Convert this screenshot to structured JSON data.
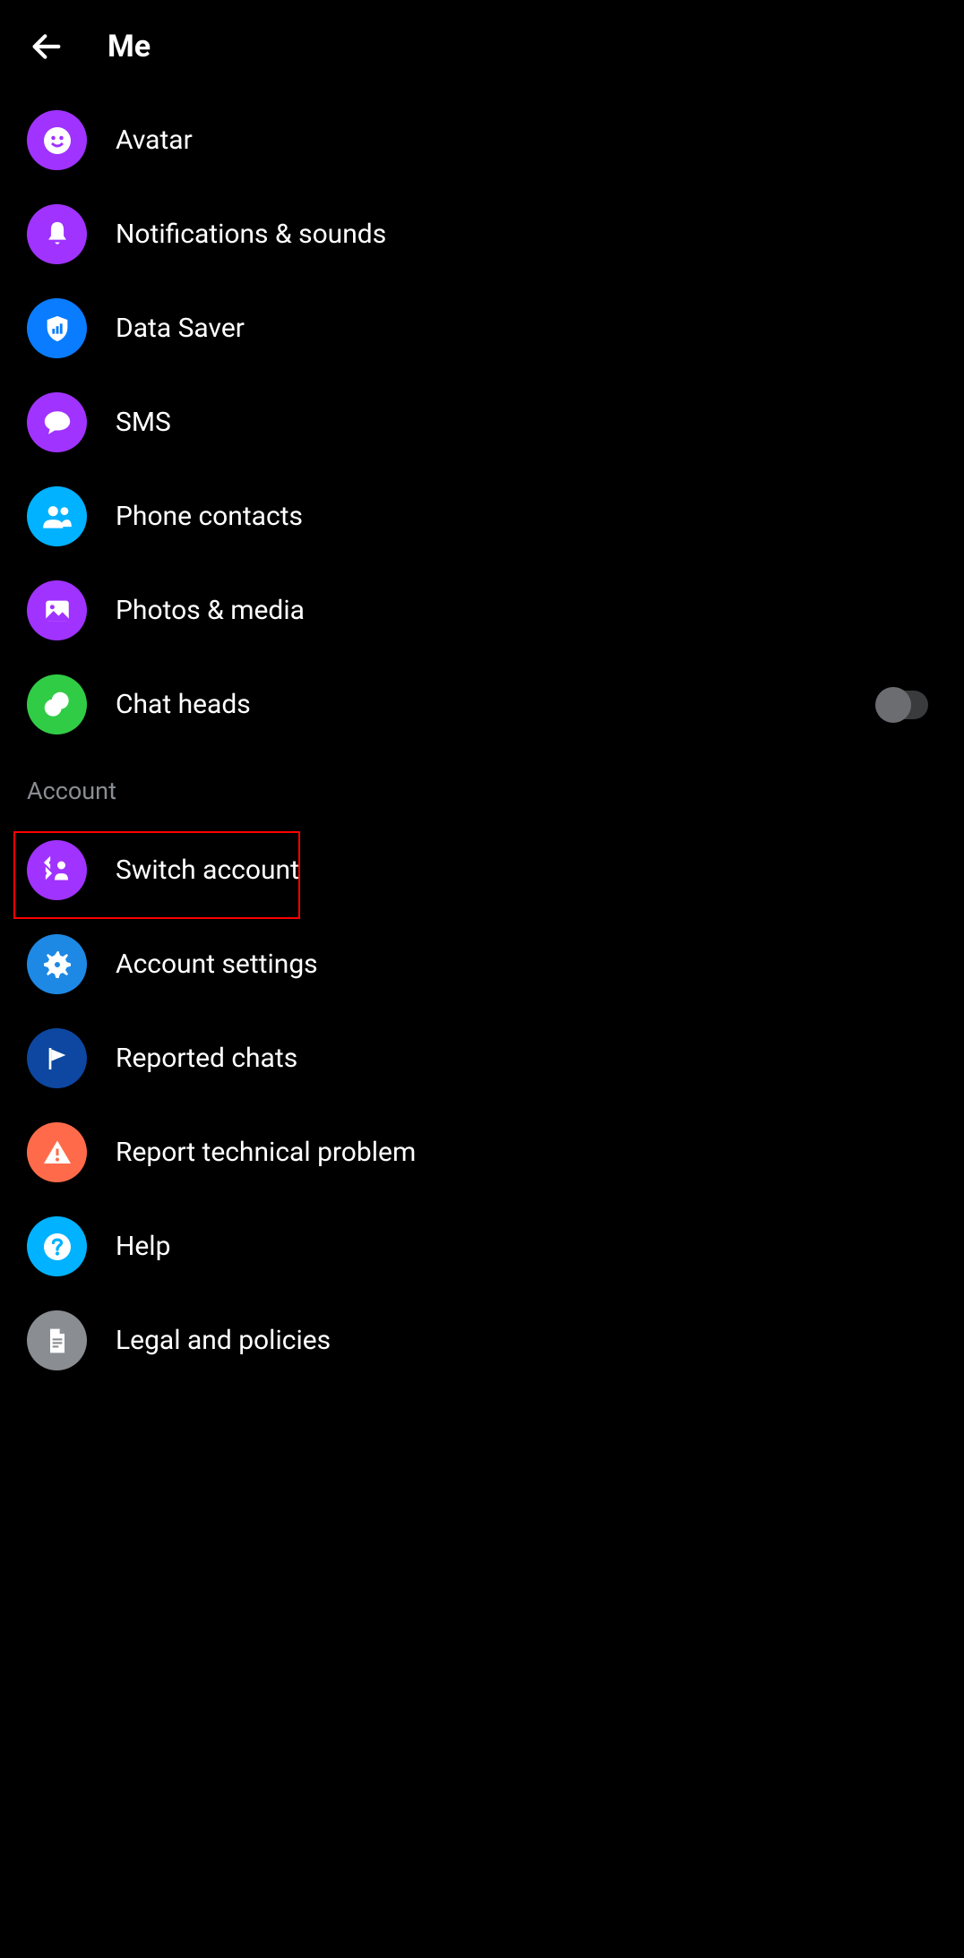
{
  "header": {
    "title": "Me"
  },
  "items": [
    {
      "icon": "avatar-icon",
      "label": "Avatar",
      "bg": "#a033ff"
    },
    {
      "icon": "bell-icon",
      "label": "Notifications & sounds",
      "bg": "#a033ff"
    },
    {
      "icon": "shield-icon",
      "label": "Data Saver",
      "bg": "#0a7cff"
    },
    {
      "icon": "chat-icon",
      "label": "SMS",
      "bg": "#a033ff"
    },
    {
      "icon": "contacts-icon",
      "label": "Phone contacts",
      "bg": "#00b2ff"
    },
    {
      "icon": "photo-icon",
      "label": "Photos & media",
      "bg": "#a033ff"
    },
    {
      "icon": "chathead-icon",
      "label": "Chat heads",
      "bg": "#31cc46",
      "toggle": false
    }
  ],
  "section_account": "Account",
  "account_items": [
    {
      "icon": "switch-icon",
      "label": "Switch account",
      "bg": "#a033ff",
      "highlight": true
    },
    {
      "icon": "gear-icon",
      "label": "Account settings",
      "bg": "#1e88e5"
    },
    {
      "icon": "flag-icon",
      "label": "Reported chats",
      "bg": "#0d47a1"
    },
    {
      "icon": "warning-icon",
      "label": "Report technical problem",
      "bg": "#ff6b4a"
    },
    {
      "icon": "help-icon",
      "label": "Help",
      "bg": "#00b2ff"
    },
    {
      "icon": "doc-icon",
      "label": "Legal and policies",
      "bg": "#8a8d91"
    }
  ]
}
